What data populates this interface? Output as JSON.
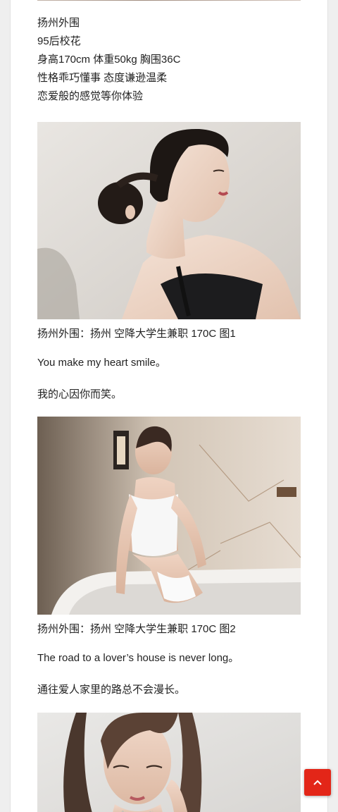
{
  "post": {
    "intro_lines": [
      "扬州外围",
      "95后校花",
      "身高170cm 体重50kg 胸围36C",
      "性格乖巧懂事 态度谦逊温柔",
      "恋爱般的感觉等你体验"
    ],
    "sections": [
      {
        "caption": "扬州外围：扬州 空降大学生兼职 170C 图1",
        "english": "You make my heart smile。",
        "chinese": "我的心因你而笑。"
      },
      {
        "caption": "扬州外围：扬州 空降大学生兼职 170C 图2",
        "english": "The road to a lover’s house is never long。",
        "chinese": "通往爱人家里的路总不会漫长。"
      }
    ]
  },
  "ui": {
    "accent": "#e32618",
    "scroll_top_icon": "chevron-up-icon"
  }
}
